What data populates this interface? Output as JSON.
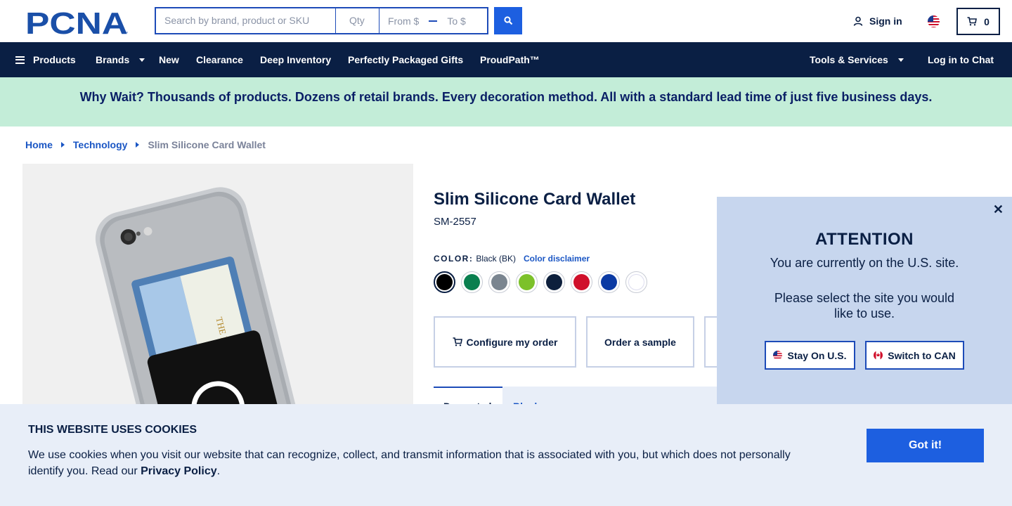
{
  "header": {
    "logo_text": "PCNA",
    "search": {
      "placeholder": "Search by brand, product or SKU",
      "qty_placeholder": "Qty",
      "from_placeholder": "From $",
      "to_placeholder": "To $"
    },
    "signin_label": "Sign in",
    "cart_count": "0"
  },
  "nav": {
    "items": [
      {
        "label": "Products"
      },
      {
        "label": "Brands"
      },
      {
        "label": "New"
      },
      {
        "label": "Clearance"
      },
      {
        "label": "Deep Inventory"
      },
      {
        "label": "Perfectly Packaged Gifts"
      },
      {
        "label": "ProudPath™"
      },
      {
        "label": "Tools & Services"
      },
      {
        "label": "Log in to Chat"
      }
    ]
  },
  "banner": {
    "text": "Why Wait? Thousands of products. Dozens of retail brands. Every decoration method. All with a standard lead time of just five business days."
  },
  "breadcrumb": [
    "Home",
    "Technology",
    "Slim Silicone Card Wallet"
  ],
  "product": {
    "title": "Slim Silicone Card Wallet",
    "sku": "SM-2557",
    "color_label": "COLOR:",
    "color_value": "Black (BK)",
    "color_disclaimer": "Color disclaimer",
    "swatches": [
      {
        "name": "black",
        "color": "#000000"
      },
      {
        "name": "green",
        "color": "#0a7f4f"
      },
      {
        "name": "gray",
        "color": "#7a8590"
      },
      {
        "name": "lime",
        "color": "#7cc12a"
      },
      {
        "name": "navy",
        "color": "#0d1f3c"
      },
      {
        "name": "red",
        "color": "#d0102b"
      },
      {
        "name": "royal-blue",
        "color": "#0b3aa3"
      },
      {
        "name": "white",
        "color": "#ffffff"
      }
    ],
    "actions": {
      "configure": "Configure my order",
      "sample": "Order a sample"
    },
    "tabs": {
      "active": "Decorated",
      "second": "Blank"
    }
  },
  "attention": {
    "title": "ATTENTION",
    "line1": "You are currently on the U.S. site.",
    "line2": "Please select the site you would like to use.",
    "stay_label": "Stay On U.S.",
    "switch_label": "Switch to CAN"
  },
  "cookies": {
    "title": "THIS WEBSITE USES COOKIES",
    "text": "We use cookies when you visit our website that can recognize, collect, and transmit information that is associated with you, but which does not personally identify you. Read our ",
    "link": "Privacy Policy",
    "end": ".",
    "button": "Got it!"
  },
  "colors": {
    "navy": "#0a1f44",
    "accent_blue": "#1d5fe0",
    "banner_green": "#c3edd8",
    "modal_bg": "#c7d6ee",
    "cookie_bg": "#e8eef8"
  }
}
